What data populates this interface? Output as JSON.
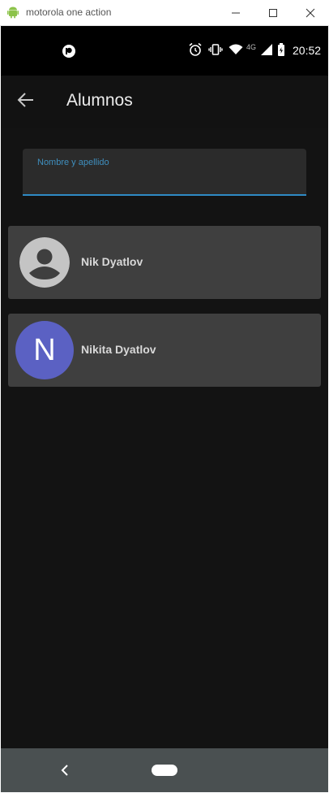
{
  "window": {
    "title": "motorola one action",
    "icons": [
      "android-icon",
      "minimize-icon",
      "maximize-icon",
      "close-icon"
    ]
  },
  "statusbar": {
    "time": "20:52",
    "network": "4G",
    "icons": [
      "notification-app-icon",
      "alarm-icon",
      "vibrate-icon",
      "wifi-icon",
      "signal-icon",
      "battery-icon"
    ]
  },
  "appbar": {
    "title": "Alumnos"
  },
  "search": {
    "label": "Nombre y apellido",
    "value": ""
  },
  "students": [
    {
      "name": "Nik Dyatlov",
      "avatar": "default-person-icon"
    },
    {
      "name": "Nikita Dyatlov",
      "avatar_letter": "N",
      "avatar_color": "#5b61c3"
    }
  ],
  "colors": {
    "background": "#131313",
    "card": "#3f3f3f",
    "accent": "#2f8ac4",
    "navbar": "#4a5051"
  }
}
